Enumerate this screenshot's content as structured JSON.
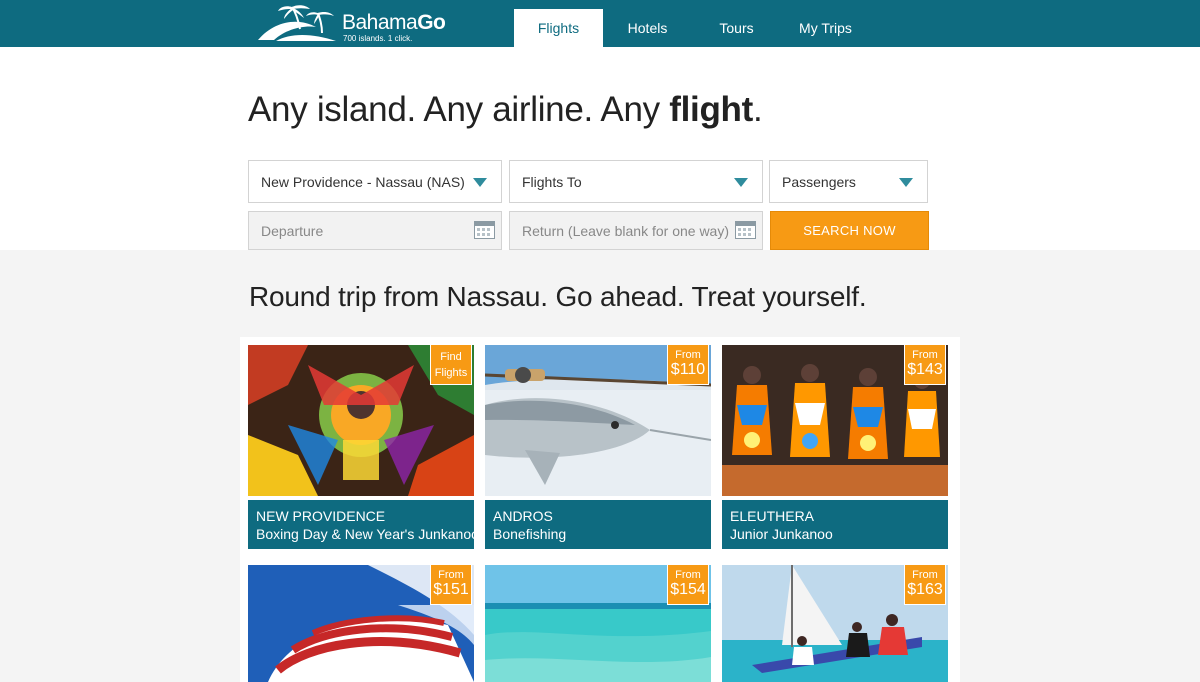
{
  "brand": {
    "name_regular": "Bahama",
    "name_bold": "Go",
    "tagline": "700 islands. 1 click."
  },
  "nav": {
    "items": [
      {
        "label": "Flights",
        "active": true
      },
      {
        "label": "Hotels",
        "active": false
      },
      {
        "label": "Tours",
        "active": false
      },
      {
        "label": "My Trips",
        "active": false
      }
    ]
  },
  "hero": {
    "title_regular": "Any island. Any airline. Any ",
    "title_bold": "flight",
    "title_end": "."
  },
  "search": {
    "from_value": "New Providence - Nassau (NAS)",
    "to_value": "Flights To",
    "passengers_value": "Passengers",
    "departure_placeholder": "Departure",
    "return_placeholder": "Return (Leave blank for one way)",
    "button_label": "SEARCH NOW"
  },
  "section": {
    "title": "Round trip from Nassau. Go ahead. Treat yourself."
  },
  "destinations": [
    {
      "destination": "NEW PROVIDENCE",
      "event": "Boxing Day & New Year's Junkanoo",
      "badge_top": "Find",
      "badge_bottom": "Flights"
    },
    {
      "destination": "ANDROS",
      "event": "Bonefishing",
      "badge_top": "From",
      "badge_bottom": "$110"
    },
    {
      "destination": "ELEUTHERA",
      "event": "Junior Junkanoo",
      "badge_top": "From",
      "badge_bottom": "$143"
    },
    {
      "destination": "",
      "event": "",
      "badge_top": "From",
      "badge_bottom": "$151"
    },
    {
      "destination": "",
      "event": "",
      "badge_top": "From",
      "badge_bottom": "$154"
    },
    {
      "destination": "",
      "event": "",
      "badge_top": "From",
      "badge_bottom": "$163"
    }
  ],
  "colors": {
    "brand_teal": "#0e6b80",
    "accent_orange": "#f79a14",
    "section_bg": "#f4f4f4"
  },
  "icons": {
    "logo": "palm-island-logo-icon",
    "dropdown": "triangle-down-icon",
    "calendar": "calendar-icon"
  }
}
